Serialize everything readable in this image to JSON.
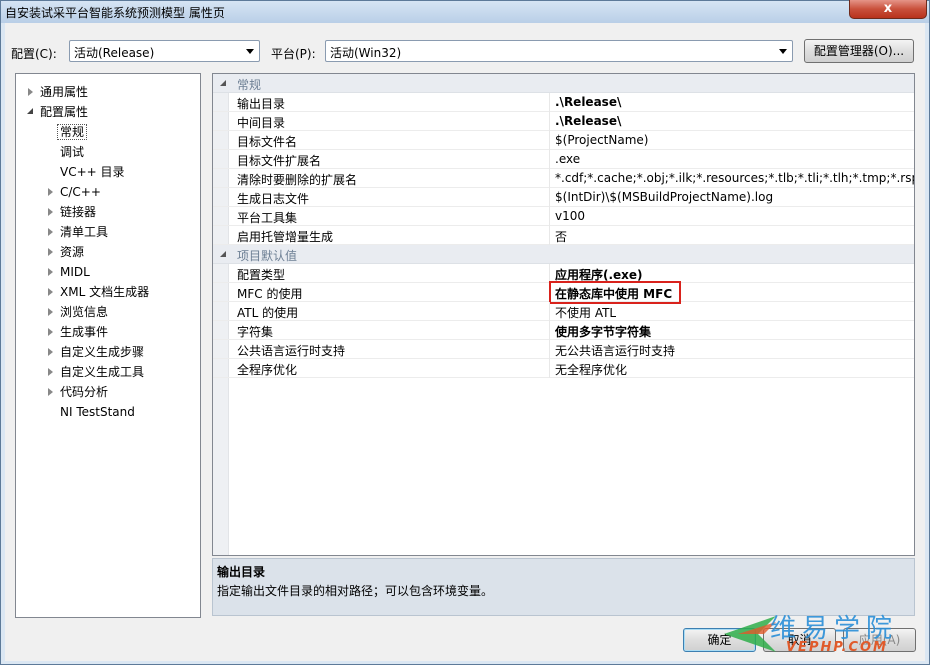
{
  "window": {
    "title": "自安装试采平台智能系统预测模型 属性页",
    "close_label": "x"
  },
  "config_row": {
    "config_label": "配置(C):",
    "config_value": "活动(Release)",
    "platform_label": "平台(P):",
    "platform_value": "活动(Win32)",
    "config_manager_button": "配置管理器(O)..."
  },
  "tree": {
    "items": [
      {
        "label": "通用属性",
        "indent": 0,
        "expander": "collapsed"
      },
      {
        "label": "配置属性",
        "indent": 0,
        "expander": "expanded"
      },
      {
        "label": "常规",
        "indent": 1,
        "expander": "none",
        "selected": true
      },
      {
        "label": "调试",
        "indent": 1,
        "expander": "none"
      },
      {
        "label": "VC++ 目录",
        "indent": 1,
        "expander": "none"
      },
      {
        "label": "C/C++",
        "indent": 1,
        "expander": "collapsed"
      },
      {
        "label": "链接器",
        "indent": 1,
        "expander": "collapsed"
      },
      {
        "label": "清单工具",
        "indent": 1,
        "expander": "collapsed"
      },
      {
        "label": "资源",
        "indent": 1,
        "expander": "collapsed"
      },
      {
        "label": "MIDL",
        "indent": 1,
        "expander": "collapsed"
      },
      {
        "label": "XML 文档生成器",
        "indent": 1,
        "expander": "collapsed"
      },
      {
        "label": "浏览信息",
        "indent": 1,
        "expander": "collapsed"
      },
      {
        "label": "生成事件",
        "indent": 1,
        "expander": "collapsed"
      },
      {
        "label": "自定义生成步骤",
        "indent": 1,
        "expander": "collapsed"
      },
      {
        "label": "自定义生成工具",
        "indent": 1,
        "expander": "collapsed"
      },
      {
        "label": "代码分析",
        "indent": 1,
        "expander": "collapsed"
      },
      {
        "label": "NI TestStand",
        "indent": 1,
        "expander": "none"
      }
    ]
  },
  "grid": {
    "sections": [
      {
        "category": "常规",
        "rows": [
          {
            "name": "输出目录",
            "value": ".\\Release\\",
            "bold": true
          },
          {
            "name": "中间目录",
            "value": ".\\Release\\",
            "bold": true
          },
          {
            "name": "目标文件名",
            "value": "$(ProjectName)",
            "bold": false
          },
          {
            "name": "目标文件扩展名",
            "value": ".exe",
            "bold": false
          },
          {
            "name": "清除时要删除的扩展名",
            "value": "*.cdf;*.cache;*.obj;*.ilk;*.resources;*.tlb;*.tli;*.tlh;*.tmp;*.rsp;*.pgc",
            "bold": false
          },
          {
            "name": "生成日志文件",
            "value": "$(IntDir)\\$(MSBuildProjectName).log",
            "bold": false
          },
          {
            "name": "平台工具集",
            "value": "v100",
            "bold": false
          },
          {
            "name": "启用托管增量生成",
            "value": "否",
            "bold": false
          }
        ]
      },
      {
        "category": "项目默认值",
        "rows": [
          {
            "name": "配置类型",
            "value": "应用程序(.exe)",
            "bold": true
          },
          {
            "name": "MFC 的使用",
            "value": "在静态库中使用 MFC",
            "bold": true,
            "highlighted": true
          },
          {
            "name": "ATL 的使用",
            "value": "不使用 ATL",
            "bold": false
          },
          {
            "name": "字符集",
            "value": "使用多字节字符集",
            "bold": true
          },
          {
            "name": "公共语言运行时支持",
            "value": "无公共语言运行时支持",
            "bold": false
          },
          {
            "name": "全程序优化",
            "value": "无全程序优化",
            "bold": false
          }
        ]
      }
    ]
  },
  "description": {
    "title": "输出目录",
    "text": "指定输出文件目录的相对路径；可以包含环境变量。"
  },
  "buttons": {
    "ok": "确定",
    "cancel": "取消",
    "apply": "应用(A)"
  },
  "watermark": {
    "cn": "维易学院",
    "en": "VEPHP.COM"
  },
  "colors": {
    "highlight_border": "#d9221c",
    "category_text": "#6d7f94",
    "watermark_blue": "#2a8fd8",
    "watermark_orange": "#e05a2a"
  }
}
